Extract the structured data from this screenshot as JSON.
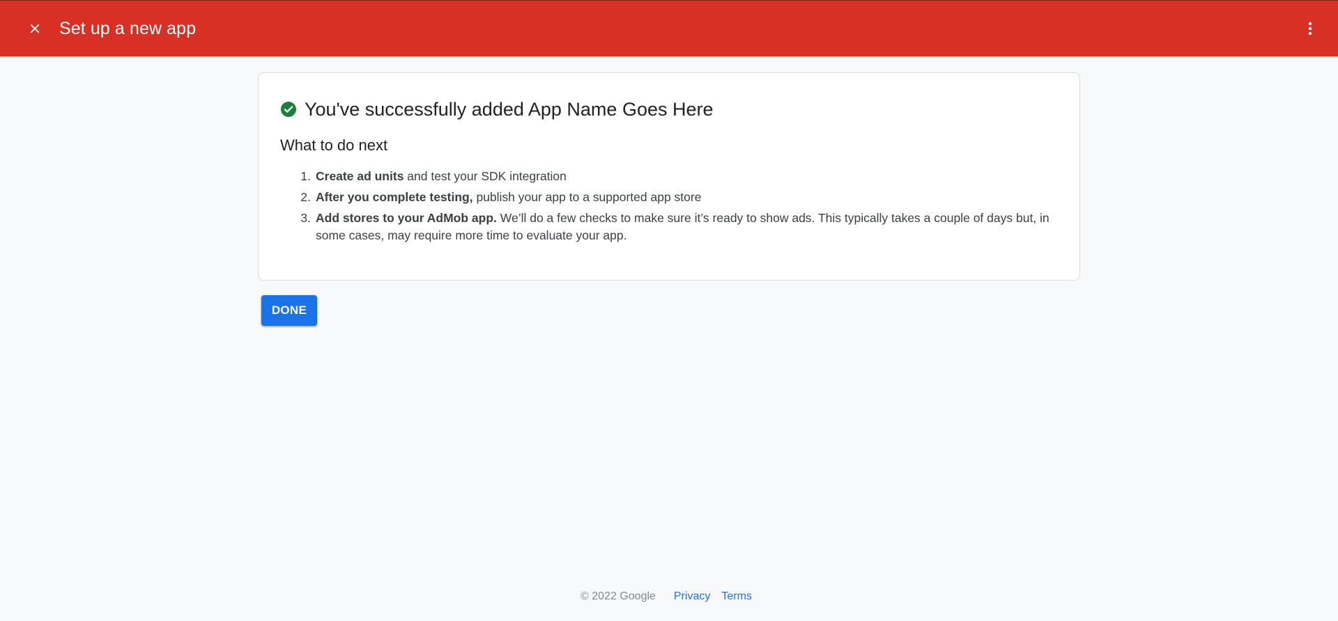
{
  "appbar": {
    "title": "Set up a new app",
    "close_icon": "close-icon",
    "more_icon": "more-vert-icon",
    "color": "#d93025"
  },
  "card": {
    "success_icon": "check-circle-icon",
    "success_color": "#188038",
    "success_title": "You've successfully added App Name Goes Here",
    "next_title": "What to do next",
    "steps": [
      {
        "number": "1.",
        "bold": "Create ad units",
        "text": " and test your SDK integration"
      },
      {
        "number": "2.",
        "bold": "After you complete testing,",
        "text": " publish your app to a supported app store"
      },
      {
        "number": "3.",
        "bold": "Add stores to your AdMob app.",
        "text": " We’ll do a few checks to make sure it’s ready to show ads. This typically takes a couple of days but, in some cases, may require more time to evaluate your app."
      }
    ]
  },
  "actions": {
    "done_label": "DONE",
    "done_color": "#1a73e8"
  },
  "footer": {
    "copyright": "© 2022 Google",
    "privacy": "Privacy",
    "terms": "Terms"
  }
}
